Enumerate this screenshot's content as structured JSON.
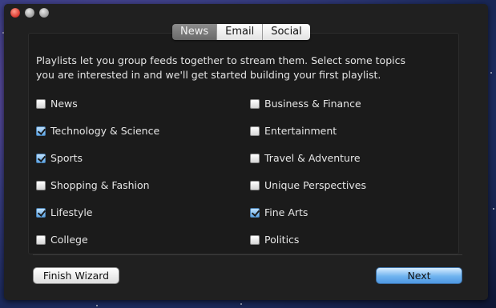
{
  "window": {
    "title_buttons": [
      "close",
      "minimize",
      "maximize"
    ]
  },
  "tabs": [
    {
      "label": "News",
      "active": true
    },
    {
      "label": "Email",
      "active": false
    },
    {
      "label": "Social",
      "active": false
    }
  ],
  "intro": {
    "line1": "Playlists let you group feeds together to stream them.  Select some topics",
    "line2": "you are interested in and we'll get started building your first playlist."
  },
  "topics": [
    {
      "label": "News",
      "checked": false
    },
    {
      "label": "Technology & Science",
      "checked": true
    },
    {
      "label": "Sports",
      "checked": true
    },
    {
      "label": "Shopping & Fashion",
      "checked": false
    },
    {
      "label": "Lifestyle",
      "checked": true
    },
    {
      "label": "College",
      "checked": false
    },
    {
      "label": "Business & Finance",
      "checked": false
    },
    {
      "label": "Entertainment",
      "checked": false
    },
    {
      "label": "Travel & Adventure",
      "checked": false
    },
    {
      "label": "Unique Perspectives",
      "checked": false
    },
    {
      "label": "Fine Arts",
      "checked": true
    },
    {
      "label": "Politics",
      "checked": false
    }
  ],
  "buttons": {
    "finish_label": "Finish Wizard",
    "next_label": "Next"
  },
  "colors": {
    "window_bg": "#202020",
    "accent_blue": "#6fb3ef"
  }
}
